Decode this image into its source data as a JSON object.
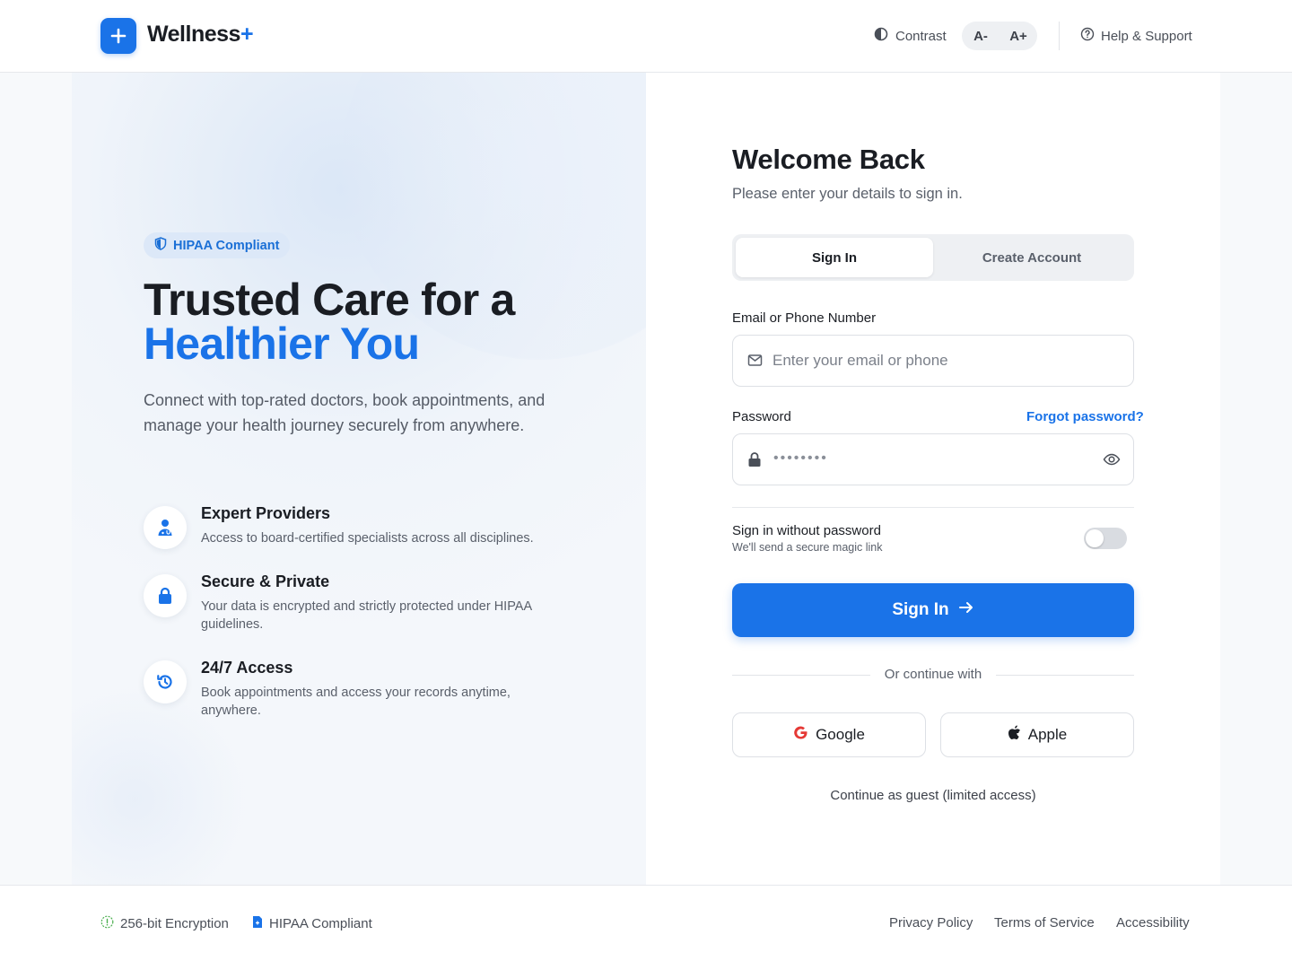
{
  "header": {
    "brand": "Wellness",
    "brand_plus": "+",
    "contrast_label": "Contrast",
    "font_decrease": "A-",
    "font_increase": "A+",
    "help_label": "Help & Support"
  },
  "hero": {
    "badge": "HIPAA Compliant",
    "title_line1": "Trusted Care for a",
    "title_line2": "Healthier You",
    "description": "Connect with top-rated doctors, book appointments, and manage your health journey securely from anywhere.",
    "features": [
      {
        "icon": "doctor-icon",
        "title": "Expert Providers",
        "desc": "Access to board-certified specialists across all disciplines."
      },
      {
        "icon": "lock-icon",
        "title": "Secure & Private",
        "desc": "Your data is encrypted and strictly protected under HIPAA guidelines."
      },
      {
        "icon": "history-icon",
        "title": "24/7 Access",
        "desc": "Book appointments and access your records anytime, anywhere."
      }
    ]
  },
  "form": {
    "title": "Welcome Back",
    "subtitle": "Please enter your details to sign in.",
    "tabs": [
      {
        "label": "Sign In",
        "active": true
      },
      {
        "label": "Create Account",
        "active": false
      }
    ],
    "email_label": "Email or Phone Number",
    "email_placeholder": "Enter your email or phone",
    "password_label": "Password",
    "password_value": "••••••••",
    "forgot_label": "Forgot password?",
    "magic_title": "Sign in without password",
    "magic_sub": "We'll send a secure magic link",
    "magic_enabled": false,
    "submit_label": "Sign In",
    "divider_text": "Or continue with",
    "google_label": "Google",
    "apple_label": "Apple",
    "guest_label": "Continue as guest (limited access)"
  },
  "footer": {
    "encryption": "256-bit Encryption",
    "hipaa": "HIPAA Compliant",
    "links": [
      "Privacy Policy",
      "Terms of Service",
      "Accessibility"
    ]
  },
  "colors": {
    "primary": "#1a73e8",
    "text": "#1a1d23",
    "muted": "#5a606b",
    "encryption_icon": "#4caf50"
  }
}
